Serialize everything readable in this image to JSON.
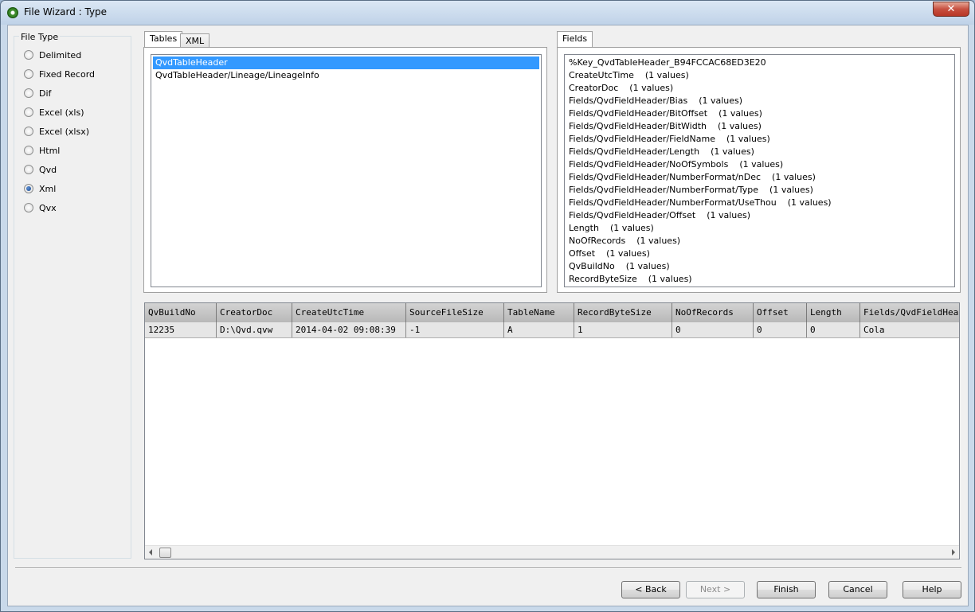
{
  "window": {
    "title": "File Wizard : Type",
    "close_glyph": "✕"
  },
  "file_type": {
    "legend": "File Type",
    "options": [
      {
        "label": "Delimited",
        "checked": false
      },
      {
        "label": "Fixed Record",
        "checked": false
      },
      {
        "label": "Dif",
        "checked": false
      },
      {
        "label": "Excel (xls)",
        "checked": false
      },
      {
        "label": "Excel (xlsx)",
        "checked": false
      },
      {
        "label": "Html",
        "checked": false
      },
      {
        "label": "Qvd",
        "checked": false
      },
      {
        "label": "Xml",
        "checked": true
      },
      {
        "label": "Qvx",
        "checked": false
      }
    ]
  },
  "tables_panel": {
    "tabs": [
      "Tables",
      "XML"
    ],
    "items": [
      {
        "label": "QvdTableHeader",
        "selected": true
      },
      {
        "label": "QvdTableHeader/Lineage/LineageInfo",
        "selected": false
      }
    ]
  },
  "fields_panel": {
    "tab": "Fields",
    "items": [
      {
        "name": "%Key_QvdTableHeader_B94FCCAC68ED3E20",
        "count": ""
      },
      {
        "name": "CreateUtcTime",
        "count": "(1 values)"
      },
      {
        "name": "CreatorDoc",
        "count": "(1 values)"
      },
      {
        "name": "Fields/QvdFieldHeader/Bias",
        "count": "(1 values)"
      },
      {
        "name": "Fields/QvdFieldHeader/BitOffset",
        "count": "(1 values)"
      },
      {
        "name": "Fields/QvdFieldHeader/BitWidth",
        "count": "(1 values)"
      },
      {
        "name": "Fields/QvdFieldHeader/FieldName",
        "count": "(1 values)"
      },
      {
        "name": "Fields/QvdFieldHeader/Length",
        "count": "(1 values)"
      },
      {
        "name": "Fields/QvdFieldHeader/NoOfSymbols",
        "count": "(1 values)"
      },
      {
        "name": "Fields/QvdFieldHeader/NumberFormat/nDec",
        "count": "(1 values)"
      },
      {
        "name": "Fields/QvdFieldHeader/NumberFormat/Type",
        "count": "(1 values)"
      },
      {
        "name": "Fields/QvdFieldHeader/NumberFormat/UseThou",
        "count": "(1 values)"
      },
      {
        "name": "Fields/QvdFieldHeader/Offset",
        "count": "(1 values)"
      },
      {
        "name": "Length",
        "count": "(1 values)"
      },
      {
        "name": "NoOfRecords",
        "count": "(1 values)"
      },
      {
        "name": "Offset",
        "count": "(1 values)"
      },
      {
        "name": "QvBuildNo",
        "count": "(1 values)"
      },
      {
        "name": "RecordByteSize",
        "count": "(1 values)"
      }
    ]
  },
  "grid": {
    "columns": [
      "QvBuildNo",
      "CreatorDoc",
      "CreateUtcTime",
      "SourceFileSize",
      "TableName",
      "RecordByteSize",
      "NoOfRecords",
      "Offset",
      "Length",
      "Fields/QvdFieldHea"
    ],
    "rows": [
      [
        "12235",
        "D:\\Qvd.qvw",
        "2014-04-02 09:08:39",
        "-1",
        "A",
        "1",
        "0",
        "0",
        "0",
        "Cola"
      ]
    ]
  },
  "buttons": {
    "back": "< Back",
    "next": "Next >",
    "finish": "Finish",
    "cancel": "Cancel",
    "help": "Help"
  }
}
